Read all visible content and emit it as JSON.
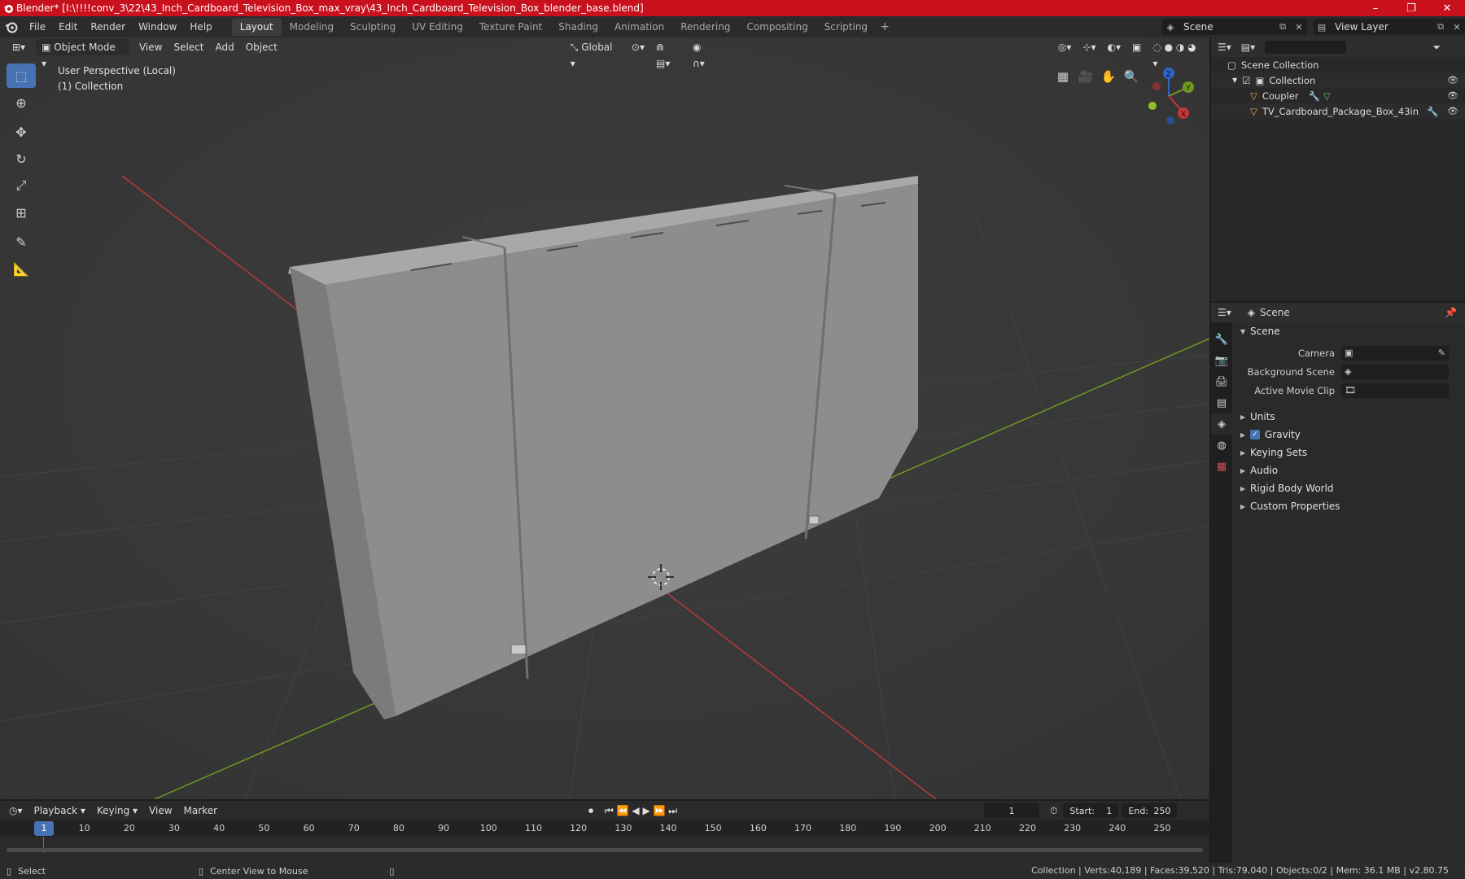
{
  "window": {
    "title": "Blender* [I:\\!!!!conv_3\\22\\43_Inch_Cardboard_Television_Box_max_vray\\43_Inch_Cardboard_Television_Box_blender_base.blend]",
    "minimize": "–",
    "maximize": "❐",
    "close": "✕"
  },
  "menu": {
    "items": [
      "File",
      "Edit",
      "Render",
      "Window",
      "Help"
    ]
  },
  "workspaces": {
    "tabs": [
      "Layout",
      "Modeling",
      "Sculpting",
      "UV Editing",
      "Texture Paint",
      "Shading",
      "Animation",
      "Rendering",
      "Compositing",
      "Scripting"
    ],
    "active": "Layout",
    "add": "+"
  },
  "scene_selector": {
    "label": "Scene"
  },
  "view_layer_selector": {
    "label": "View Layer"
  },
  "viewport": {
    "mode": "Object Mode",
    "menus": [
      "View",
      "Select",
      "Add",
      "Object"
    ],
    "transform_orientation": "Global",
    "info_line1": "User Perspective (Local)",
    "info_line2": "(1) Collection",
    "gizmo": {
      "x": "X",
      "y": "Y",
      "z": "Z"
    },
    "colors": {
      "background": "#393939",
      "x_axis": "#b8393c",
      "y_axis": "#6f9a1e",
      "box": "#8c8c8c",
      "active_tool": "#4772b3"
    }
  },
  "outliner": {
    "root": "Scene Collection",
    "collection": "Collection",
    "items": [
      "Coupler",
      "TV_Cardboard_Package_Box_43in"
    ]
  },
  "properties": {
    "header": "Scene",
    "panel_scene": "Scene",
    "fields": [
      {
        "label": "Camera"
      },
      {
        "label": "Background Scene"
      },
      {
        "label": "Active Movie Clip"
      }
    ],
    "panels": [
      "Units",
      "Gravity",
      "Keying Sets",
      "Audio",
      "Rigid Body World",
      "Custom Properties"
    ]
  },
  "timeline": {
    "menus": [
      "Playback",
      "Keying",
      "View",
      "Marker"
    ],
    "current_frame": "1",
    "start_label": "Start:",
    "start": "1",
    "end_label": "End:",
    "end": "250",
    "ticks": [
      "10",
      "20",
      "30",
      "40",
      "50",
      "60",
      "70",
      "80",
      "90",
      "100",
      "110",
      "120",
      "130",
      "140",
      "150",
      "160",
      "170",
      "180",
      "190",
      "200",
      "210",
      "220",
      "230",
      "240",
      "250"
    ]
  },
  "statusbar": {
    "left": "Select",
    "middle": "Center View to Mouse",
    "right": "Collection | Verts:40,189 | Faces:39,520 | Tris:79,040 | Objects:0/2 | Mem: 36.1 MB | v2.80.75"
  }
}
